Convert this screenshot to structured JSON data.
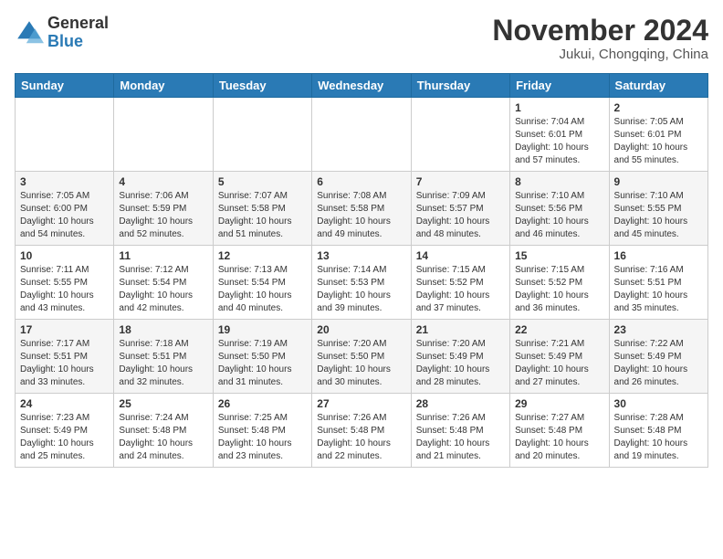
{
  "header": {
    "logo_general": "General",
    "logo_blue": "Blue",
    "month_title": "November 2024",
    "location": "Jukui, Chongqing, China"
  },
  "weekdays": [
    "Sunday",
    "Monday",
    "Tuesday",
    "Wednesday",
    "Thursday",
    "Friday",
    "Saturday"
  ],
  "weeks": [
    [
      {
        "day": "",
        "info": ""
      },
      {
        "day": "",
        "info": ""
      },
      {
        "day": "",
        "info": ""
      },
      {
        "day": "",
        "info": ""
      },
      {
        "day": "",
        "info": ""
      },
      {
        "day": "1",
        "info": "Sunrise: 7:04 AM\nSunset: 6:01 PM\nDaylight: 10 hours and 57 minutes."
      },
      {
        "day": "2",
        "info": "Sunrise: 7:05 AM\nSunset: 6:01 PM\nDaylight: 10 hours and 55 minutes."
      }
    ],
    [
      {
        "day": "3",
        "info": "Sunrise: 7:05 AM\nSunset: 6:00 PM\nDaylight: 10 hours and 54 minutes."
      },
      {
        "day": "4",
        "info": "Sunrise: 7:06 AM\nSunset: 5:59 PM\nDaylight: 10 hours and 52 minutes."
      },
      {
        "day": "5",
        "info": "Sunrise: 7:07 AM\nSunset: 5:58 PM\nDaylight: 10 hours and 51 minutes."
      },
      {
        "day": "6",
        "info": "Sunrise: 7:08 AM\nSunset: 5:58 PM\nDaylight: 10 hours and 49 minutes."
      },
      {
        "day": "7",
        "info": "Sunrise: 7:09 AM\nSunset: 5:57 PM\nDaylight: 10 hours and 48 minutes."
      },
      {
        "day": "8",
        "info": "Sunrise: 7:10 AM\nSunset: 5:56 PM\nDaylight: 10 hours and 46 minutes."
      },
      {
        "day": "9",
        "info": "Sunrise: 7:10 AM\nSunset: 5:55 PM\nDaylight: 10 hours and 45 minutes."
      }
    ],
    [
      {
        "day": "10",
        "info": "Sunrise: 7:11 AM\nSunset: 5:55 PM\nDaylight: 10 hours and 43 minutes."
      },
      {
        "day": "11",
        "info": "Sunrise: 7:12 AM\nSunset: 5:54 PM\nDaylight: 10 hours and 42 minutes."
      },
      {
        "day": "12",
        "info": "Sunrise: 7:13 AM\nSunset: 5:54 PM\nDaylight: 10 hours and 40 minutes."
      },
      {
        "day": "13",
        "info": "Sunrise: 7:14 AM\nSunset: 5:53 PM\nDaylight: 10 hours and 39 minutes."
      },
      {
        "day": "14",
        "info": "Sunrise: 7:15 AM\nSunset: 5:52 PM\nDaylight: 10 hours and 37 minutes."
      },
      {
        "day": "15",
        "info": "Sunrise: 7:15 AM\nSunset: 5:52 PM\nDaylight: 10 hours and 36 minutes."
      },
      {
        "day": "16",
        "info": "Sunrise: 7:16 AM\nSunset: 5:51 PM\nDaylight: 10 hours and 35 minutes."
      }
    ],
    [
      {
        "day": "17",
        "info": "Sunrise: 7:17 AM\nSunset: 5:51 PM\nDaylight: 10 hours and 33 minutes."
      },
      {
        "day": "18",
        "info": "Sunrise: 7:18 AM\nSunset: 5:51 PM\nDaylight: 10 hours and 32 minutes."
      },
      {
        "day": "19",
        "info": "Sunrise: 7:19 AM\nSunset: 5:50 PM\nDaylight: 10 hours and 31 minutes."
      },
      {
        "day": "20",
        "info": "Sunrise: 7:20 AM\nSunset: 5:50 PM\nDaylight: 10 hours and 30 minutes."
      },
      {
        "day": "21",
        "info": "Sunrise: 7:20 AM\nSunset: 5:49 PM\nDaylight: 10 hours and 28 minutes."
      },
      {
        "day": "22",
        "info": "Sunrise: 7:21 AM\nSunset: 5:49 PM\nDaylight: 10 hours and 27 minutes."
      },
      {
        "day": "23",
        "info": "Sunrise: 7:22 AM\nSunset: 5:49 PM\nDaylight: 10 hours and 26 minutes."
      }
    ],
    [
      {
        "day": "24",
        "info": "Sunrise: 7:23 AM\nSunset: 5:49 PM\nDaylight: 10 hours and 25 minutes."
      },
      {
        "day": "25",
        "info": "Sunrise: 7:24 AM\nSunset: 5:48 PM\nDaylight: 10 hours and 24 minutes."
      },
      {
        "day": "26",
        "info": "Sunrise: 7:25 AM\nSunset: 5:48 PM\nDaylight: 10 hours and 23 minutes."
      },
      {
        "day": "27",
        "info": "Sunrise: 7:26 AM\nSunset: 5:48 PM\nDaylight: 10 hours and 22 minutes."
      },
      {
        "day": "28",
        "info": "Sunrise: 7:26 AM\nSunset: 5:48 PM\nDaylight: 10 hours and 21 minutes."
      },
      {
        "day": "29",
        "info": "Sunrise: 7:27 AM\nSunset: 5:48 PM\nDaylight: 10 hours and 20 minutes."
      },
      {
        "day": "30",
        "info": "Sunrise: 7:28 AM\nSunset: 5:48 PM\nDaylight: 10 hours and 19 minutes."
      }
    ]
  ]
}
